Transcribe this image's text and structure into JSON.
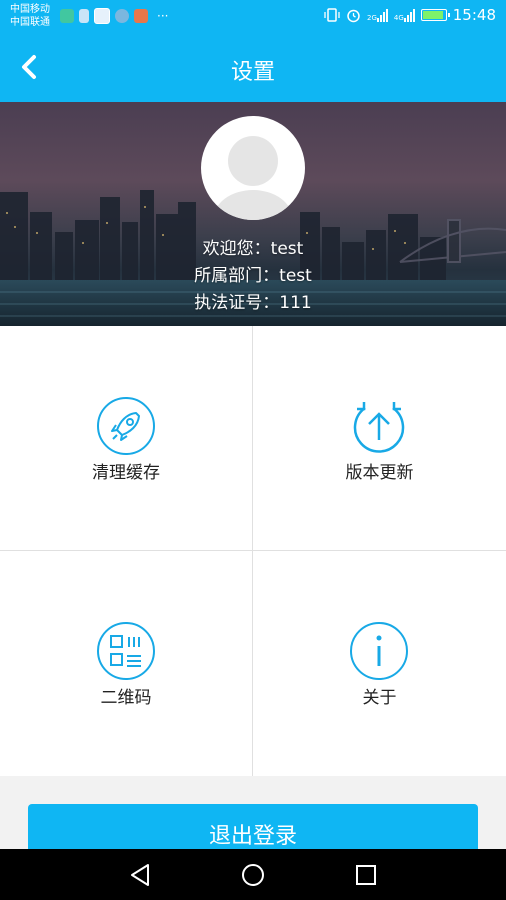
{
  "status_bar": {
    "carrier_1": "中国移动",
    "carrier_2": "中国联通",
    "network_1": "2G",
    "network_2": "4G",
    "time": "15:48",
    "overflow": "···"
  },
  "header": {
    "title": "设置",
    "back_icon": "chevron-left-icon"
  },
  "profile": {
    "welcome": "欢迎您：test",
    "department": "所属部门：test",
    "license": "执法证号：111"
  },
  "menu": [
    {
      "label": "清理缓存",
      "icon": "rocket-icon"
    },
    {
      "label": "版本更新",
      "icon": "update-arrow-icon"
    },
    {
      "label": "二维码",
      "icon": "qrcode-icon"
    },
    {
      "label": "关于",
      "icon": "info-icon"
    }
  ],
  "logout": {
    "label": "退出登录"
  },
  "colors": {
    "primary": "#0fb6f3",
    "divider": "#e0e0e0",
    "background": "#f2f2f2"
  }
}
